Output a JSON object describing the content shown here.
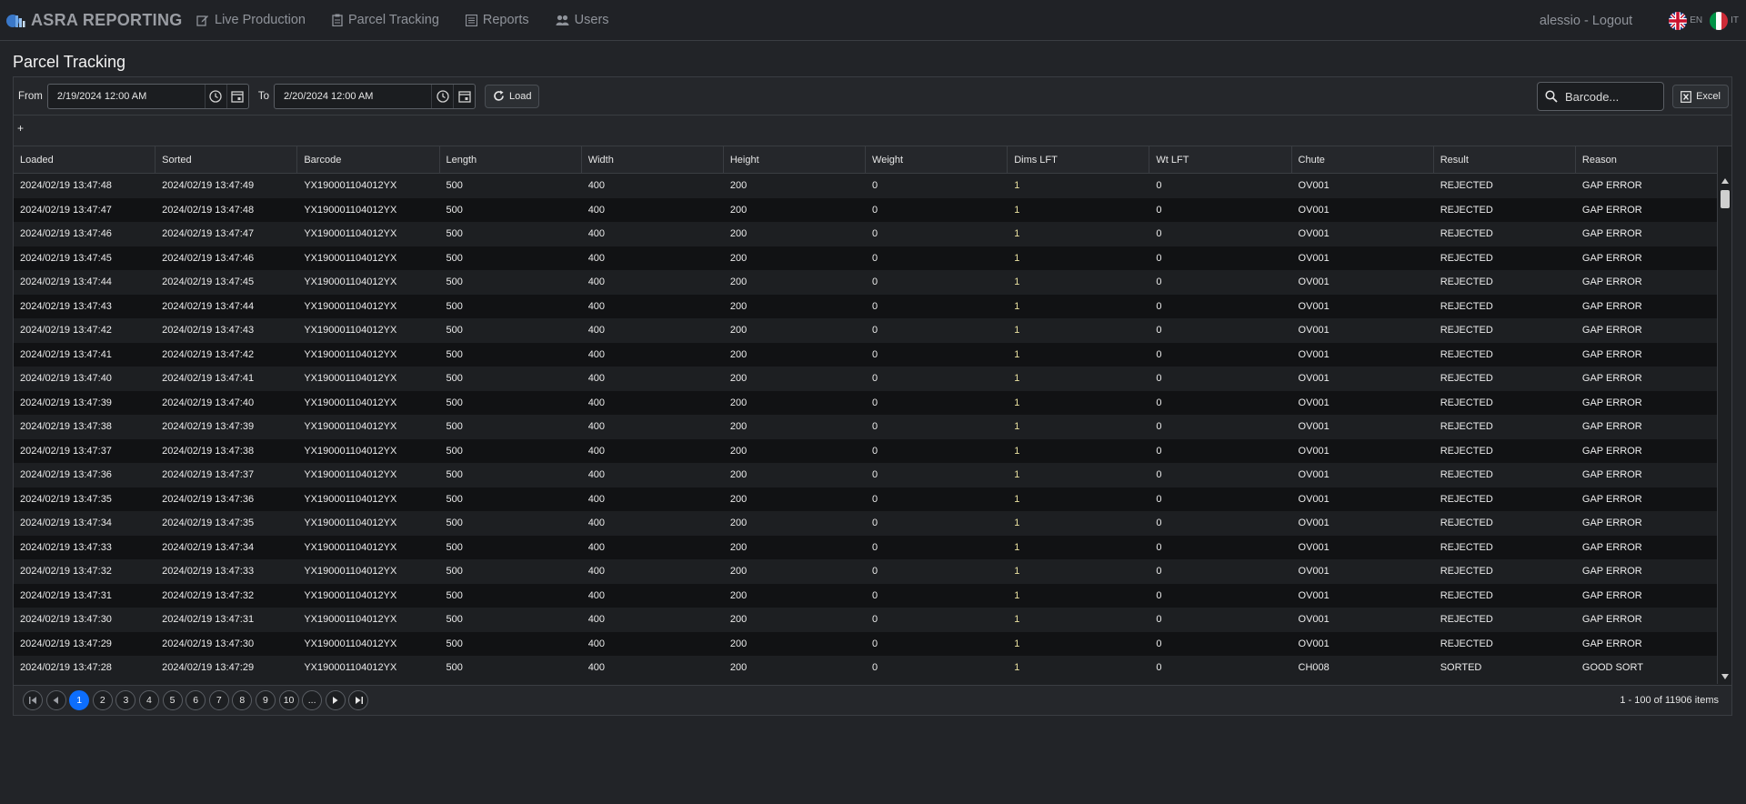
{
  "nav": {
    "brand": "ASRA REPORTING",
    "links": [
      "Live Production",
      "Parcel Tracking",
      "Reports",
      "Users"
    ],
    "user": "alessio - Logout",
    "lang_en": "EN",
    "lang_it": "IT"
  },
  "page_title": "Parcel Tracking",
  "toolbar": {
    "from_label": "From",
    "from_value": "2/19/2024 12:00 AM",
    "to_label": "To",
    "to_value": "2/20/2024 12:00 AM",
    "load_label": "Load",
    "search_placeholder": "Barcode...",
    "excel_label": "Excel"
  },
  "group_add": "+",
  "columns": [
    "Loaded",
    "Sorted",
    "Barcode",
    "Length",
    "Width",
    "Height",
    "Weight",
    "Dims LFT",
    "Wt LFT",
    "Chute",
    "Result",
    "Reason"
  ],
  "rows": [
    [
      "2024/02/19 13:47:48",
      "2024/02/19 13:47:49",
      "YX190001104012YX",
      "500",
      "400",
      "200",
      "0",
      "1",
      "0",
      "OV001",
      "REJECTED",
      "GAP ERROR"
    ],
    [
      "2024/02/19 13:47:47",
      "2024/02/19 13:47:48",
      "YX190001104012YX",
      "500",
      "400",
      "200",
      "0",
      "1",
      "0",
      "OV001",
      "REJECTED",
      "GAP ERROR"
    ],
    [
      "2024/02/19 13:47:46",
      "2024/02/19 13:47:47",
      "YX190001104012YX",
      "500",
      "400",
      "200",
      "0",
      "1",
      "0",
      "OV001",
      "REJECTED",
      "GAP ERROR"
    ],
    [
      "2024/02/19 13:47:45",
      "2024/02/19 13:47:46",
      "YX190001104012YX",
      "500",
      "400",
      "200",
      "0",
      "1",
      "0",
      "OV001",
      "REJECTED",
      "GAP ERROR"
    ],
    [
      "2024/02/19 13:47:44",
      "2024/02/19 13:47:45",
      "YX190001104012YX",
      "500",
      "400",
      "200",
      "0",
      "1",
      "0",
      "OV001",
      "REJECTED",
      "GAP ERROR"
    ],
    [
      "2024/02/19 13:47:43",
      "2024/02/19 13:47:44",
      "YX190001104012YX",
      "500",
      "400",
      "200",
      "0",
      "1",
      "0",
      "OV001",
      "REJECTED",
      "GAP ERROR"
    ],
    [
      "2024/02/19 13:47:42",
      "2024/02/19 13:47:43",
      "YX190001104012YX",
      "500",
      "400",
      "200",
      "0",
      "1",
      "0",
      "OV001",
      "REJECTED",
      "GAP ERROR"
    ],
    [
      "2024/02/19 13:47:41",
      "2024/02/19 13:47:42",
      "YX190001104012YX",
      "500",
      "400",
      "200",
      "0",
      "1",
      "0",
      "OV001",
      "REJECTED",
      "GAP ERROR"
    ],
    [
      "2024/02/19 13:47:40",
      "2024/02/19 13:47:41",
      "YX190001104012YX",
      "500",
      "400",
      "200",
      "0",
      "1",
      "0",
      "OV001",
      "REJECTED",
      "GAP ERROR"
    ],
    [
      "2024/02/19 13:47:39",
      "2024/02/19 13:47:40",
      "YX190001104012YX",
      "500",
      "400",
      "200",
      "0",
      "1",
      "0",
      "OV001",
      "REJECTED",
      "GAP ERROR"
    ],
    [
      "2024/02/19 13:47:38",
      "2024/02/19 13:47:39",
      "YX190001104012YX",
      "500",
      "400",
      "200",
      "0",
      "1",
      "0",
      "OV001",
      "REJECTED",
      "GAP ERROR"
    ],
    [
      "2024/02/19 13:47:37",
      "2024/02/19 13:47:38",
      "YX190001104012YX",
      "500",
      "400",
      "200",
      "0",
      "1",
      "0",
      "OV001",
      "REJECTED",
      "GAP ERROR"
    ],
    [
      "2024/02/19 13:47:36",
      "2024/02/19 13:47:37",
      "YX190001104012YX",
      "500",
      "400",
      "200",
      "0",
      "1",
      "0",
      "OV001",
      "REJECTED",
      "GAP ERROR"
    ],
    [
      "2024/02/19 13:47:35",
      "2024/02/19 13:47:36",
      "YX190001104012YX",
      "500",
      "400",
      "200",
      "0",
      "1",
      "0",
      "OV001",
      "REJECTED",
      "GAP ERROR"
    ],
    [
      "2024/02/19 13:47:34",
      "2024/02/19 13:47:35",
      "YX190001104012YX",
      "500",
      "400",
      "200",
      "0",
      "1",
      "0",
      "OV001",
      "REJECTED",
      "GAP ERROR"
    ],
    [
      "2024/02/19 13:47:33",
      "2024/02/19 13:47:34",
      "YX190001104012YX",
      "500",
      "400",
      "200",
      "0",
      "1",
      "0",
      "OV001",
      "REJECTED",
      "GAP ERROR"
    ],
    [
      "2024/02/19 13:47:32",
      "2024/02/19 13:47:33",
      "YX190001104012YX",
      "500",
      "400",
      "200",
      "0",
      "1",
      "0",
      "OV001",
      "REJECTED",
      "GAP ERROR"
    ],
    [
      "2024/02/19 13:47:31",
      "2024/02/19 13:47:32",
      "YX190001104012YX",
      "500",
      "400",
      "200",
      "0",
      "1",
      "0",
      "OV001",
      "REJECTED",
      "GAP ERROR"
    ],
    [
      "2024/02/19 13:47:30",
      "2024/02/19 13:47:31",
      "YX190001104012YX",
      "500",
      "400",
      "200",
      "0",
      "1",
      "0",
      "OV001",
      "REJECTED",
      "GAP ERROR"
    ],
    [
      "2024/02/19 13:47:29",
      "2024/02/19 13:47:30",
      "YX190001104012YX",
      "500",
      "400",
      "200",
      "0",
      "1",
      "0",
      "OV001",
      "REJECTED",
      "GAP ERROR"
    ],
    [
      "2024/02/19 13:47:28",
      "2024/02/19 13:47:29",
      "YX190001104012YX",
      "500",
      "400",
      "200",
      "0",
      "1",
      "0",
      "CH008",
      "SORTED",
      "GOOD SORT"
    ]
  ],
  "pager": {
    "pages": [
      "1",
      "2",
      "3",
      "4",
      "5",
      "6",
      "7",
      "8",
      "9",
      "10",
      "..."
    ],
    "current": "1",
    "info": "1 - 100 of 11906 items"
  },
  "colors": {
    "accent": "#0d6efd",
    "dims_lft_highlight": "#e8e0a0"
  }
}
